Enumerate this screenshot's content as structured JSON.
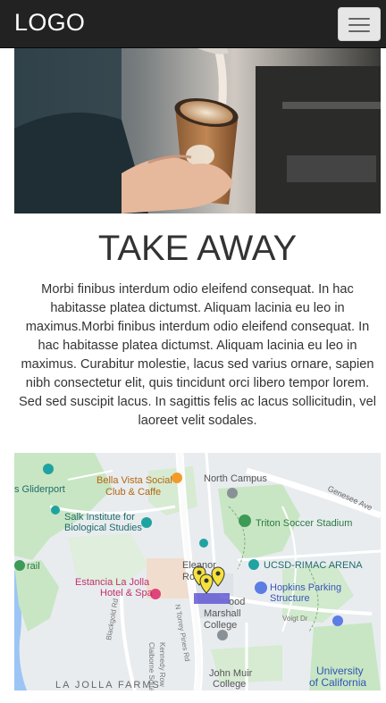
{
  "navbar": {
    "logo": "LOGO",
    "menu_icon": "hamburger-menu-icon"
  },
  "hero": {
    "image": "barista pouring latte art into takeaway cup"
  },
  "section": {
    "title": "TAKE AWAY",
    "body": "Morbi finibus interdum odio eleifend consequat. In hac habitasse platea dictumst. Aliquam lacinia eu leo in maximus.Morbi finibus interdum odio eleifend consequat. In hac habitasse platea dictumst. Aliquam lacinia eu leo in maximus. Curabitur molestie, lacus sed varius ornare, sapien nibh consectetur elit, quis tincidunt orci libero tempor lorem. Sed sed suscipit lacus. In sagittis felis ac lacus sollicitudin, vel laoreet velit sodales."
  },
  "map": {
    "labels": {
      "gliderport": "s Gliderport",
      "bella_vista_1": "Bella Vista Social",
      "bella_vista_2": "Club & Caffe",
      "north_campus": "North Campus",
      "genesee": "Genesee Ave",
      "salk_1": "Salk Institute for",
      "salk_2": "Biological Studies",
      "triton": "Triton Soccer Stadium",
      "trail": "rail",
      "eleanor_1": "Eleanor",
      "eleanor_2": "Ro",
      "rimac": "UCSD-RIMAC ARENA",
      "estancia_1": "Estancia La Jolla",
      "estancia_2": "Hotel & Spa",
      "hopkins_1": "Hopkins Parking",
      "hopkins_2": "Structure",
      "rood": "ood",
      "marshall_1": "Marshall",
      "marshall_2": "College",
      "blackgold": "Blackgold Rd",
      "kennedy": "Kennedy Row",
      "torrey": "N Torrey Pines Rd",
      "claiborne": "Claiborne Square",
      "voigt": "Voigt Dr",
      "muir_1": "John Muir",
      "muir_2": "College",
      "uc_1": "University",
      "uc_2": "of California",
      "farms": "LA JOLLA FARMS"
    },
    "colors": {
      "land": "#e8ecef",
      "park": "#c8e6c3",
      "water": "#9cc5f5",
      "road": "#ffffff",
      "poi_teal": "#1fa3a0",
      "poi_orange": "#f29b2a",
      "poi_pink": "#e0457b",
      "poi_green": "#3d9a57",
      "poi_blue": "#5b7de4",
      "marker": "#f5e23c"
    }
  }
}
